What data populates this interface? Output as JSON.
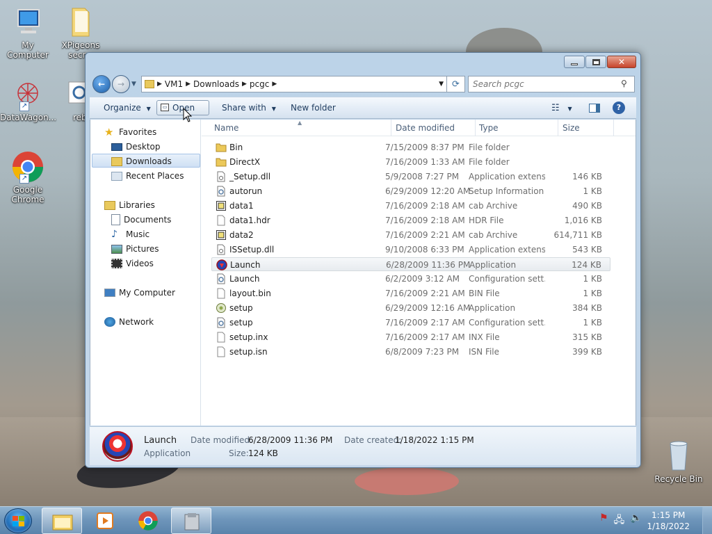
{
  "desktop": {
    "icons": [
      {
        "label": "My Computer"
      },
      {
        "label": "XPigeons secr..."
      },
      {
        "label": "DataWagon..."
      },
      {
        "label": "rebo"
      },
      {
        "label": "Google Chrome"
      },
      {
        "label": "Recycle Bin"
      }
    ]
  },
  "window": {
    "address": {
      "crumbs": [
        "VM1",
        "Downloads",
        "pcgc"
      ]
    },
    "search": {
      "placeholder": "Search pcgc"
    },
    "toolbar": {
      "organize": "Organize",
      "open": "Open",
      "share_with": "Share with",
      "new_folder": "New folder"
    },
    "nav": {
      "favorites": "Favorites",
      "desktop": "Desktop",
      "downloads": "Downloads",
      "recent_places": "Recent Places",
      "libraries": "Libraries",
      "documents": "Documents",
      "music": "Music",
      "pictures": "Pictures",
      "videos": "Videos",
      "my_computer": "My Computer",
      "network": "Network"
    },
    "columns": {
      "name": "Name",
      "date_modified": "Date modified",
      "type": "Type",
      "size": "Size"
    },
    "files": [
      {
        "name": "Bin",
        "date": "7/15/2009 8:37 PM",
        "type": "File folder",
        "size": "",
        "icon": "folder-icon"
      },
      {
        "name": "DirectX",
        "date": "7/16/2009 1:33 AM",
        "type": "File folder",
        "size": "",
        "icon": "folder-icon"
      },
      {
        "name": "_Setup.dll",
        "date": "5/9/2008 7:27 PM",
        "type": "Application extens...",
        "size": "146 KB",
        "icon": "dll-file-icon"
      },
      {
        "name": "autorun",
        "date": "6/29/2009 12:20 AM",
        "type": "Setup Information",
        "size": "1 KB",
        "icon": "settings-file-icon"
      },
      {
        "name": "data1",
        "date": "7/16/2009 2:18 AM",
        "type": "cab Archive",
        "size": "490 KB",
        "icon": "cab-file-icon"
      },
      {
        "name": "data1.hdr",
        "date": "7/16/2009 2:18 AM",
        "type": "HDR File",
        "size": "1,016 KB",
        "icon": "blank-file-icon"
      },
      {
        "name": "data2",
        "date": "7/16/2009 2:21 AM",
        "type": "cab Archive",
        "size": "614,711 KB",
        "icon": "cab-file-icon"
      },
      {
        "name": "ISSetup.dll",
        "date": "9/10/2008 6:33 PM",
        "type": "Application extens...",
        "size": "543 KB",
        "icon": "dll-file-icon"
      },
      {
        "name": "Launch",
        "date": "6/28/2009 11:36 PM",
        "type": "Application",
        "size": "124 KB",
        "icon": "app-launch-icon",
        "selected": true
      },
      {
        "name": "Launch",
        "date": "6/2/2009 3:12 AM",
        "type": "Configuration sett...",
        "size": "1 KB",
        "icon": "settings-file-icon"
      },
      {
        "name": "layout.bin",
        "date": "7/16/2009 2:21 AM",
        "type": "BIN File",
        "size": "1 KB",
        "icon": "blank-file-icon"
      },
      {
        "name": "setup",
        "date": "6/29/2009 12:16 AM",
        "type": "Application",
        "size": "384 KB",
        "icon": "setup-app-icon"
      },
      {
        "name": "setup",
        "date": "7/16/2009 2:17 AM",
        "type": "Configuration sett...",
        "size": "1 KB",
        "icon": "settings-file-icon"
      },
      {
        "name": "setup.inx",
        "date": "7/16/2009 2:17 AM",
        "type": "INX File",
        "size": "315 KB",
        "icon": "blank-file-icon"
      },
      {
        "name": "setup.isn",
        "date": "6/8/2009 7:23 PM",
        "type": "ISN File",
        "size": "399 KB",
        "icon": "blank-file-icon"
      }
    ],
    "details": {
      "name": "Launch",
      "type": "Application",
      "date_modified_label": "Date modified:",
      "date_modified": "6/28/2009 11:36 PM",
      "date_created_label": "Date created:",
      "date_created": "1/18/2022 1:15 PM",
      "size_label": "Size:",
      "size": "124 KB"
    }
  },
  "taskbar": {
    "time": "1:15 PM",
    "date": "1/18/2022"
  },
  "colors": {
    "accent": "#1d5fa9",
    "selection": "#cfe0f4"
  }
}
